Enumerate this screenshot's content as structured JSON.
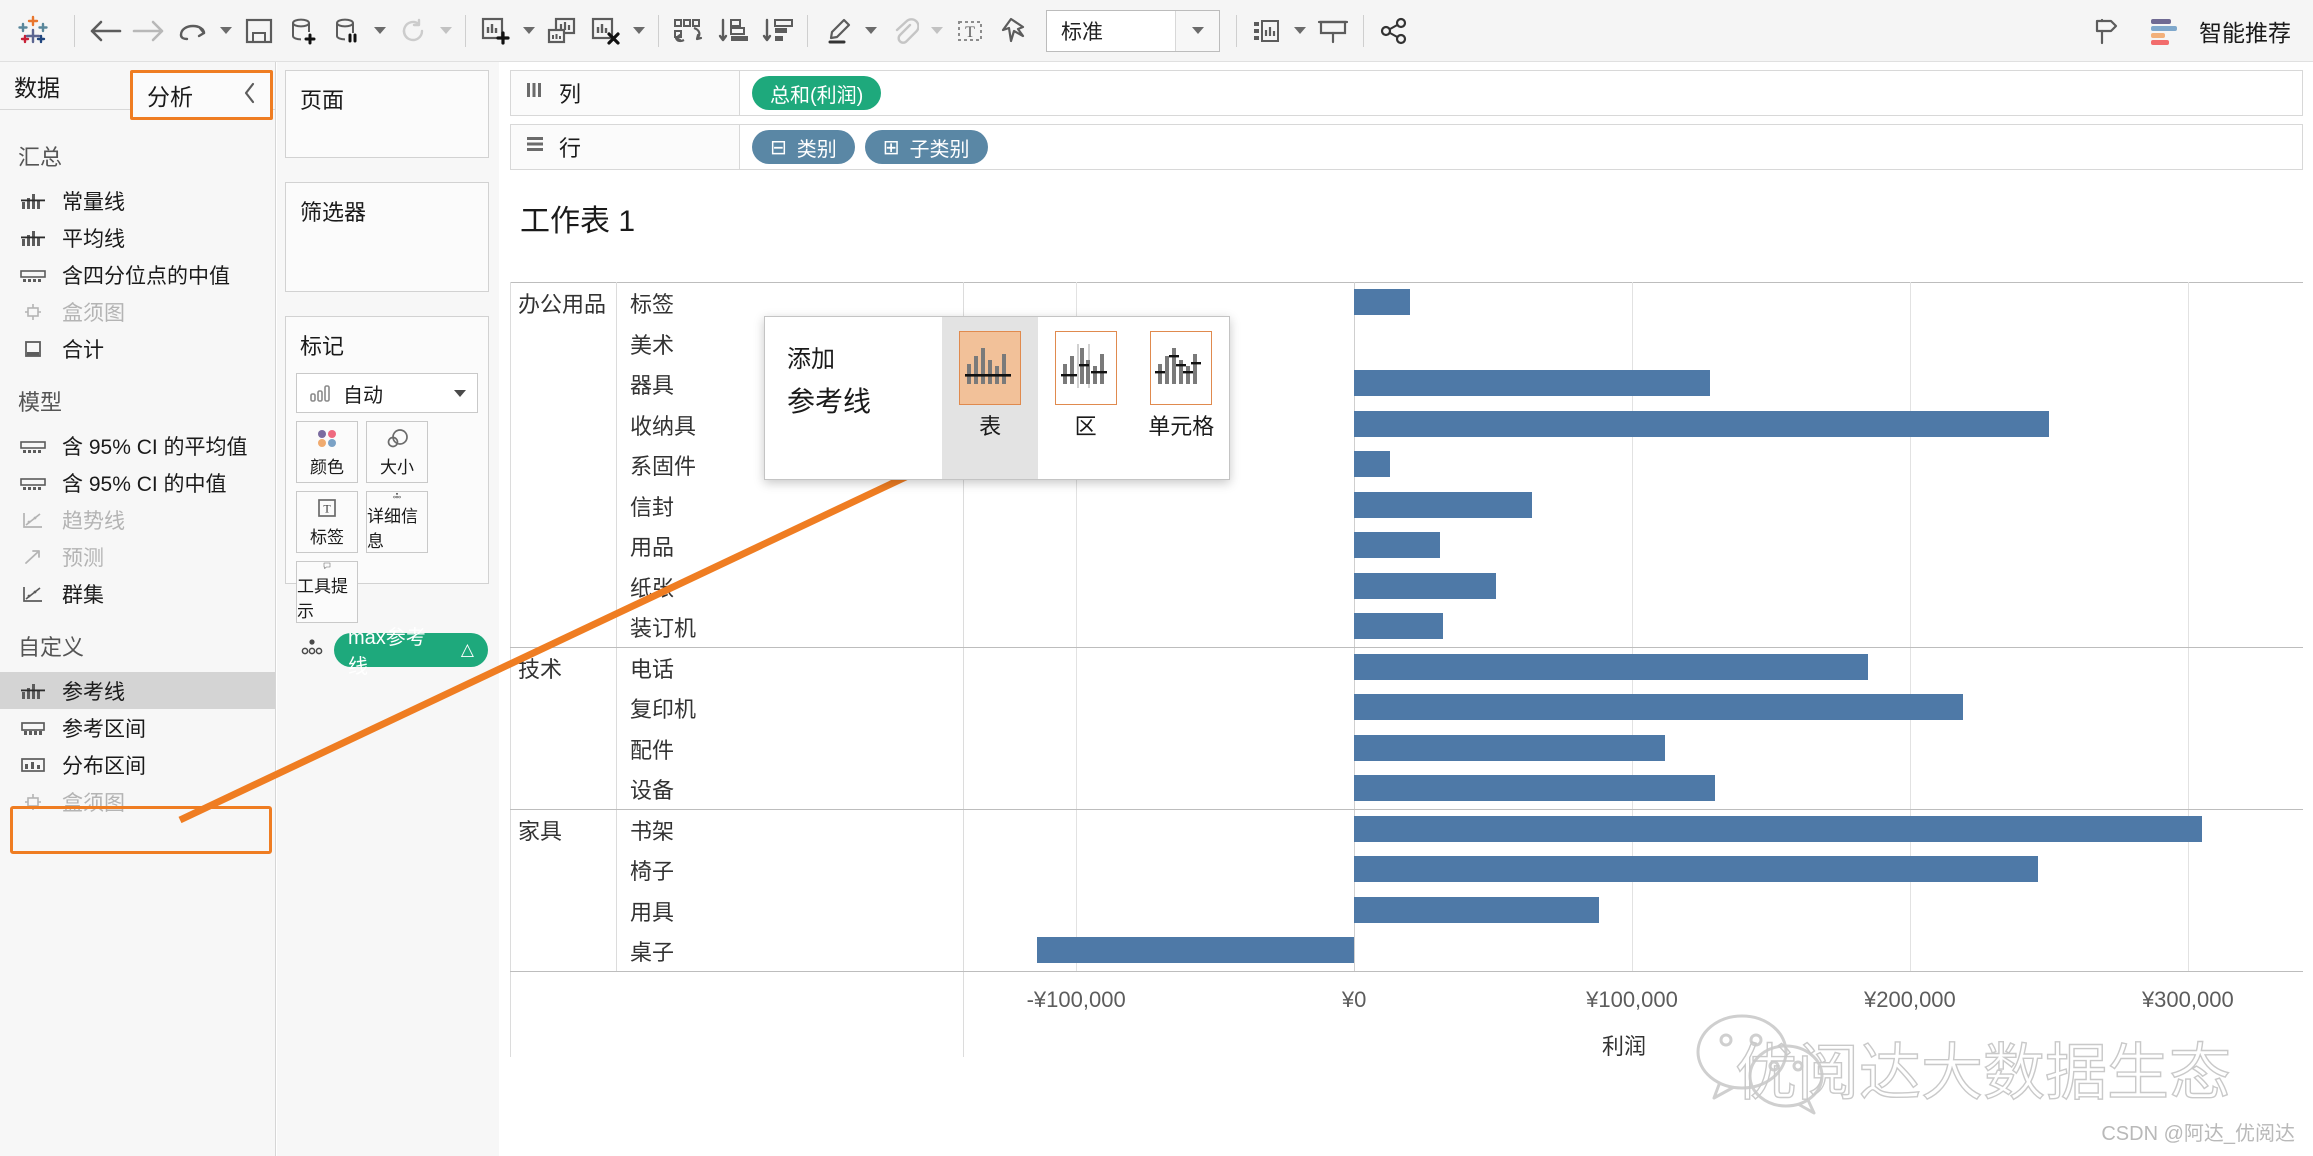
{
  "toolbar": {
    "logo": "tableau-logo",
    "buttons": [
      {
        "name": "back-button",
        "icon": "arrow-left-icon"
      },
      {
        "name": "forward-button",
        "icon": "arrow-right-icon"
      },
      {
        "name": "undo-redo-button",
        "icon": "redo-loop-icon",
        "caret": true
      },
      {
        "name": "save-button",
        "icon": "save-disk-icon"
      },
      {
        "name": "new-data-source-button",
        "icon": "database-plus-icon"
      },
      {
        "name": "pause-data-source-button",
        "icon": "database-pause-icon",
        "caret": true
      },
      {
        "name": "refresh-data-source-button",
        "icon": "refresh-circle-icon",
        "caret": true,
        "disabled": true
      },
      {
        "name": "new-worksheet-button",
        "icon": "chart-plus-icon",
        "caret": true
      },
      {
        "name": "duplicate-sheet-button",
        "icon": "chart-duplicate-icon"
      },
      {
        "name": "clear-sheet-button",
        "icon": "chart-clear-icon",
        "caret": true
      },
      {
        "name": "swap-rows-columns-button",
        "icon": "swap-axes-icon"
      },
      {
        "name": "sort-ascending-button",
        "icon": "sort-ascending-icon"
      },
      {
        "name": "sort-descending-button",
        "icon": "sort-descending-icon"
      },
      {
        "name": "highlighter-button",
        "icon": "highlighter-icon",
        "caret": true
      },
      {
        "name": "attachment-button",
        "icon": "paperclip-icon",
        "caret": true,
        "disabled": true
      },
      {
        "name": "text-box-button",
        "icon": "text-box-icon"
      },
      {
        "name": "fix-axis-button",
        "icon": "pin-icon"
      }
    ],
    "fit_select": {
      "value": "标准",
      "name": "fit-select"
    },
    "right_buttons": [
      {
        "name": "show-hide-cards-button",
        "icon": "cards-icon",
        "caret": true
      },
      {
        "name": "presentation-mode-button",
        "icon": "presentation-icon"
      },
      {
        "name": "share-button",
        "icon": "share-icon"
      },
      {
        "name": "show-me-pin-button",
        "icon": "pin-outline-icon"
      }
    ],
    "smart_recommend_label": "智能推荐",
    "smart_recommend_icon": "show-me-bars-icon"
  },
  "left_panel": {
    "tab_data": "数据",
    "tab_analytics": "分析",
    "collapse_icon": "chevron-left-icon",
    "groups": [
      {
        "title": "汇总",
        "items": [
          {
            "label": "常量线",
            "icon": "constant-line-icon",
            "disabled": false,
            "selected": false
          },
          {
            "label": "平均线",
            "icon": "average-line-icon",
            "disabled": false,
            "selected": false
          },
          {
            "label": "含四分位点的中值",
            "icon": "median-quartiles-icon",
            "disabled": false,
            "selected": false
          },
          {
            "label": "盒须图",
            "icon": "box-plot-icon",
            "disabled": true,
            "selected": false
          },
          {
            "label": "合计",
            "icon": "totals-icon",
            "disabled": false,
            "selected": false
          }
        ]
      },
      {
        "title": "模型",
        "items": [
          {
            "label": "含 95% CI 的平均值",
            "icon": "average-ci-icon",
            "disabled": false,
            "selected": false
          },
          {
            "label": "含 95% CI 的中值",
            "icon": "median-ci-icon",
            "disabled": false,
            "selected": false
          },
          {
            "label": "趋势线",
            "icon": "trend-line-icon",
            "disabled": true,
            "selected": false
          },
          {
            "label": "预测",
            "icon": "forecast-icon",
            "disabled": true,
            "selected": false
          },
          {
            "label": "群集",
            "icon": "cluster-icon",
            "disabled": false,
            "selected": false
          }
        ]
      },
      {
        "title": "自定义",
        "items": [
          {
            "label": "参考线",
            "icon": "reference-line-icon",
            "disabled": false,
            "selected": true
          },
          {
            "label": "参考区间",
            "icon": "reference-band-icon",
            "disabled": false,
            "selected": false
          },
          {
            "label": "分布区间",
            "icon": "distribution-band-icon",
            "disabled": false,
            "selected": false
          },
          {
            "label": "盒须图",
            "icon": "box-plot-icon",
            "disabled": true,
            "selected": false
          }
        ]
      }
    ]
  },
  "cards": {
    "pages_title": "页面",
    "filters_title": "筛选器",
    "marks_title": "标记",
    "marks_type": {
      "value": "自动",
      "icon": "bar-mark-icon",
      "dropdown_icon": "chevron-down-icon"
    },
    "mark_properties": [
      {
        "label": "颜色",
        "icon": "color-dots-icon"
      },
      {
        "label": "大小",
        "icon": "size-circles-icon"
      },
      {
        "label": "标签",
        "icon": "label-T-icon"
      },
      {
        "label": "详细信息",
        "icon": "detail-dots-icon"
      },
      {
        "label": "工具提示",
        "icon": "tooltip-bubble-icon"
      }
    ],
    "detail_pill": {
      "label": "max参考线",
      "icon": "detail-dots-icon",
      "badge": "△",
      "color": "#1ea97c"
    }
  },
  "shelves": {
    "columns_label": "列",
    "columns_icon": "columns-icon",
    "columns_pills": [
      {
        "label": "总和(利润)",
        "color": "green"
      }
    ],
    "rows_label": "行",
    "rows_icon": "rows-icon",
    "rows_pills": [
      {
        "label": "类别",
        "color": "blue",
        "prefix": "⊟"
      },
      {
        "label": "子类别",
        "color": "blue",
        "prefix": "⊞"
      }
    ]
  },
  "worksheet": {
    "title": "工作表 1"
  },
  "popup": {
    "title_line1": "添加",
    "title_line2": "参考线",
    "options": [
      {
        "label": "表",
        "icon": "scope-table-icon",
        "active": true
      },
      {
        "label": "区",
        "icon": "scope-pane-icon",
        "active": false
      },
      {
        "label": "单元格",
        "icon": "scope-cell-icon",
        "active": false
      }
    ]
  },
  "chart_data": {
    "type": "bar",
    "title": "工作表 1",
    "xlabel": "利润",
    "ylabel": "",
    "xticks": [
      "-¥100,000",
      "¥0",
      "¥100,000",
      "¥200,000",
      "¥300,000"
    ],
    "xtick_values": [
      -100000,
      0,
      100000,
      200000,
      300000
    ],
    "xlim": [
      -140000,
      340000
    ],
    "bar_color": "#4e79a7",
    "grid": true,
    "legend": "none",
    "groups": [
      {
        "category": "办公用品",
        "items": [
          {
            "subcategory": "标签",
            "value": 20000
          },
          {
            "subcategory": "美术",
            "value": 0
          },
          {
            "subcategory": "器具",
            "value": 128000
          },
          {
            "subcategory": "收纳具",
            "value": 250000
          },
          {
            "subcategory": "系固件",
            "value": 13000
          },
          {
            "subcategory": "信封",
            "value": 64000
          },
          {
            "subcategory": "用品",
            "value": 31000
          },
          {
            "subcategory": "纸张",
            "value": 51000
          },
          {
            "subcategory": "装订机",
            "value": 32000
          }
        ]
      },
      {
        "category": "技术",
        "items": [
          {
            "subcategory": "电话",
            "value": 185000
          },
          {
            "subcategory": "复印机",
            "value": 219000
          },
          {
            "subcategory": "配件",
            "value": 112000
          },
          {
            "subcategory": "设备",
            "value": 130000
          }
        ]
      },
      {
        "category": "家具",
        "items": [
          {
            "subcategory": "书架",
            "value": 305000
          },
          {
            "subcategory": "椅子",
            "value": 246000
          },
          {
            "subcategory": "用具",
            "value": 88000
          },
          {
            "subcategory": "桌子",
            "value": -114000
          }
        ]
      }
    ]
  },
  "watermark": {
    "text": "优阅达大数据生态",
    "wechat_icon": "wechat-icon",
    "credit": "CSDN @阿达_优阅达"
  }
}
